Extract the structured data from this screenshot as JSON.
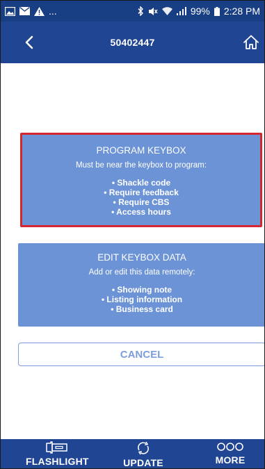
{
  "status_bar": {
    "left_icons": [
      "image-icon",
      "mail-icon",
      "warning-icon"
    ],
    "ellipsis": "...",
    "battery": "99%",
    "time": "2:28 PM"
  },
  "header": {
    "title": "50402447"
  },
  "program_card": {
    "title": "PROGRAM KEYBOX",
    "subtitle": "Must be near the keybox to program:",
    "items": [
      "• Shackle code",
      "• Require feedback",
      "• Require CBS",
      "• Access hours"
    ]
  },
  "edit_card": {
    "title": "EDIT KEYBOX DATA",
    "subtitle": "Add or edit this data remotely:",
    "items": [
      "• Showing note",
      "• Listing information",
      "• Business card"
    ]
  },
  "cancel_label": "CANCEL",
  "bottom_nav": {
    "flashlight": "FLASHLIGHT",
    "update": "UPDATE",
    "more": "MORE"
  },
  "colors": {
    "status_bar": "#183e83",
    "header": "#1f4593",
    "card": "#6c93d5",
    "highlight": "#d4262e",
    "cancel_text": "#7c9ede"
  }
}
